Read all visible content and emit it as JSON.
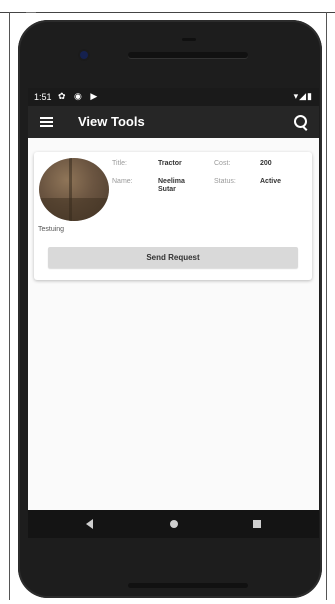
{
  "status_bar": {
    "time": "1:51",
    "left_icons": "✿ ◉ ▶",
    "right_icons": "▾◢▮"
  },
  "app_bar": {
    "title": "View Tools",
    "menu_icon": "hamburger-icon",
    "search_icon": "search-icon"
  },
  "tool_card": {
    "title_label": "Title:",
    "title_value": "Tractor",
    "cost_label": "Cost:",
    "cost_value": "200",
    "name_label": "Name:",
    "name_value_line1": "Neelima",
    "name_value_line2": "Sutar",
    "status_label": "Status:",
    "status_value": "Active",
    "caption": "Testuing",
    "send_button_label": "Send Request"
  },
  "navigation": {
    "back_icon": "back-triangle-icon",
    "home_icon": "home-circle-icon",
    "recents_icon": "recents-square-icon"
  },
  "colors": {
    "app_bar": "#262626",
    "status_bar": "#1a1a1a",
    "button": "#d9d9d9",
    "screen_bg": "#fafafa"
  }
}
